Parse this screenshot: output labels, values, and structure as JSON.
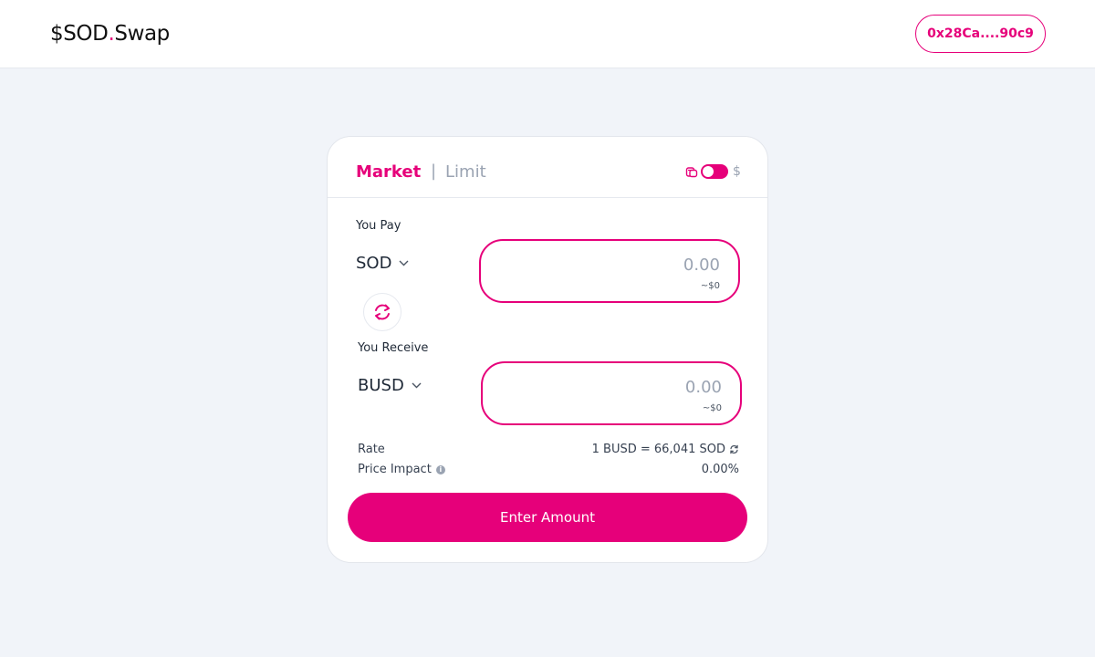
{
  "header": {
    "logo_prefix": "$SOD",
    "logo_dot": ".",
    "logo_suffix": "Swap",
    "wallet_address": "0x28Ca....90c9"
  },
  "tabs": {
    "market": "Market",
    "separator": "|",
    "limit": "Limit",
    "active": "Market"
  },
  "currency_toggle": {
    "left_icon": "coins-icon",
    "right_label": "$",
    "state": "on"
  },
  "pay": {
    "label": "You Pay",
    "token": "SOD",
    "amount_placeholder": "0.00",
    "usd_value": "~$0"
  },
  "receive": {
    "label": "You Receive",
    "token": "BUSD",
    "amount_placeholder": "0.00",
    "usd_value": "~$0"
  },
  "rate": {
    "label": "Rate",
    "value": "1 BUSD = 66,041 SOD"
  },
  "price_impact": {
    "label": "Price Impact",
    "value": "0.00%"
  },
  "submit": {
    "label": "Enter Amount"
  },
  "colors": {
    "accent": "#e6007a",
    "background": "#f1f4f9",
    "muted": "#9aa3b2"
  }
}
